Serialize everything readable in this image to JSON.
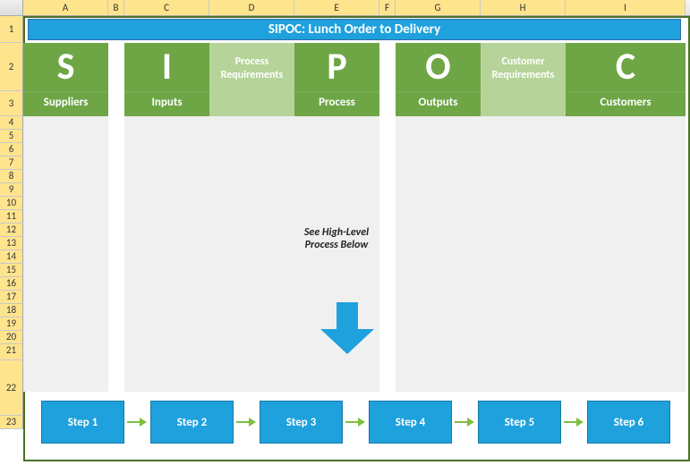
{
  "columns": [
    "A",
    "B",
    "C",
    "D",
    "E",
    "F",
    "G",
    "H",
    "I"
  ],
  "rows": [
    "1",
    "2",
    "3",
    "4",
    "5",
    "6",
    "7",
    "8",
    "9",
    "10",
    "11",
    "12",
    "13",
    "14",
    "15",
    "16",
    "17",
    "18",
    "19",
    "20",
    "21",
    "22",
    "23"
  ],
  "title": "SIPOC: Lunch Order to Delivery",
  "headers": {
    "s": {
      "letter": "S",
      "label": "Suppliers"
    },
    "i": {
      "letter": "I",
      "label": "Inputs"
    },
    "preq": "Process Requirements",
    "p": {
      "letter": "P",
      "label": "Process"
    },
    "o": {
      "letter": "O",
      "label": "Outputs"
    },
    "creq": "Customer Requirements",
    "c": {
      "letter": "C",
      "label": "Customers"
    }
  },
  "hlp": {
    "line1": "See High-Level",
    "line2": "Process Below"
  },
  "steps": [
    "Step 1",
    "Step 2",
    "Step 3",
    "Step 4",
    "Step 5",
    "Step 6"
  ]
}
